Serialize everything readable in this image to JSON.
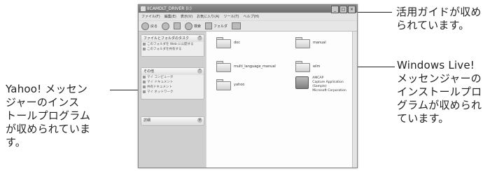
{
  "callouts": {
    "guide": "活用ガイドが収め\nられています。",
    "windows_live": "Windows Live!\nメッセンジャーの\nインストールプロ\nグラムが収められ\nています。",
    "yahoo": "Yahoo! メッセン\nジャーのインス\nトールプログラム\nが収められていま\nす。"
  },
  "window": {
    "title": "IICAMDLT_DRIVER (I:)",
    "menu": [
      "ファイル(F)",
      "編集(E)",
      "表示(V)",
      "お気に入り(A)",
      "ツール(T)",
      "ヘルプ(H)"
    ],
    "toolbar": {
      "back": "戻る",
      "search": "検索",
      "folders": "フォルダ"
    }
  },
  "left_panel": {
    "tasks_title": "ファイルとフォルダのタスク",
    "tasks": [
      "このフォルダを Web に公開する",
      "このフォルダを共有する"
    ],
    "places_title": "その他",
    "places": [
      "マイ コンピュータ",
      "マイ ドキュメント",
      "共有ドキュメント",
      "マイ ネットワーク"
    ],
    "details_title": "詳細"
  },
  "files": [
    {
      "name": "doc",
      "type": "folder"
    },
    {
      "name": "manual",
      "type": "folder"
    },
    {
      "name": "multi_language_manual",
      "type": "folder"
    },
    {
      "name": "wlm",
      "type": "folder"
    },
    {
      "name": "yahoo",
      "type": "folder"
    },
    {
      "name": "AMCAP",
      "type": "app",
      "desc1": "Capture Application (Sample)",
      "desc2": "Microsoft Corporation"
    }
  ]
}
